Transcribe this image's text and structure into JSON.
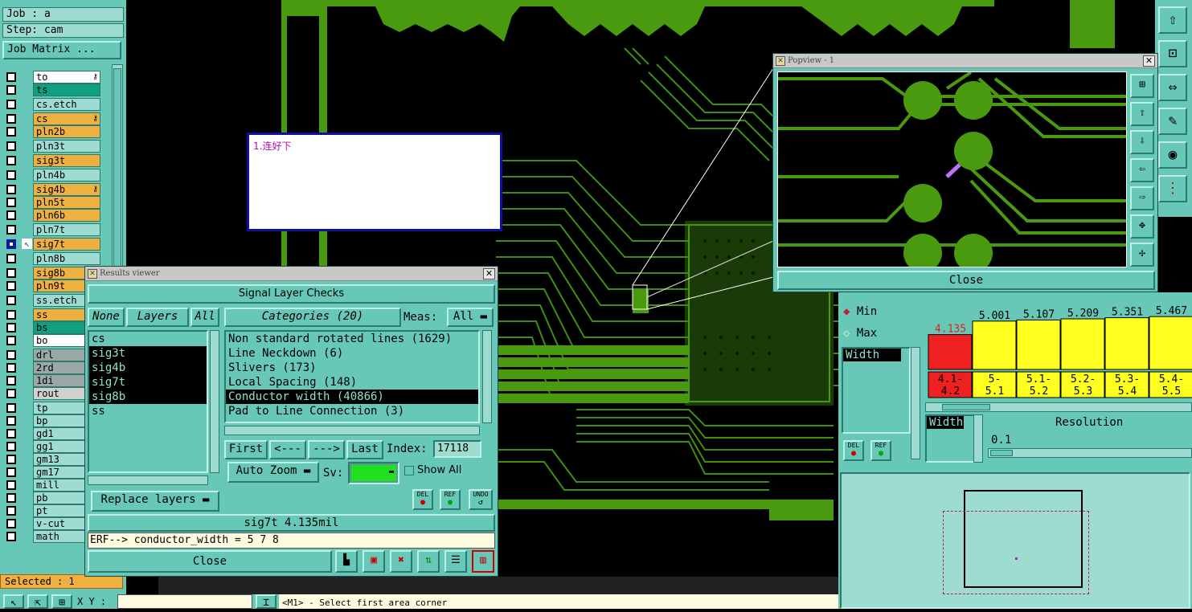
{
  "job": {
    "job_label": "Job : a",
    "step_label": "Step: cam",
    "matrix_button": "Job Matrix ..."
  },
  "layers": [
    {
      "name": "to",
      "color": "#ffffff",
      "lock": true
    },
    {
      "name": "ts",
      "color": "#10a080",
      "lock": false
    },
    {
      "name": "cs.etch",
      "color": "#9edbd0",
      "lock": false
    },
    {
      "name": "cs",
      "color": "#f0b040",
      "lock": true
    },
    {
      "name": "pln2b",
      "color": "#f0b040",
      "lock": false
    },
    {
      "name": "pln3t",
      "color": "#9edbd0",
      "lock": false
    },
    {
      "name": "sig3t",
      "color": "#f0b040",
      "lock": false
    },
    {
      "name": "pln4b",
      "color": "#9edbd0",
      "lock": false
    },
    {
      "name": "sig4b",
      "color": "#f0b040",
      "lock": true
    },
    {
      "name": "pln5t",
      "color": "#f0b040",
      "lock": false
    },
    {
      "name": "pln6b",
      "color": "#f0b040",
      "lock": false
    },
    {
      "name": "pln7t",
      "color": "#9edbd0",
      "lock": false
    },
    {
      "name": "sig7t",
      "color": "#f0b040",
      "lock": false,
      "selected": true
    },
    {
      "name": "pln8b",
      "color": "#9edbd0",
      "lock": false
    },
    {
      "name": "sig8b",
      "color": "#f0b040",
      "lock": false
    },
    {
      "name": "pln9t",
      "color": "#f0b040",
      "lock": false
    },
    {
      "name": "ss.etch",
      "color": "#9edbd0",
      "lock": false
    },
    {
      "name": "ss",
      "color": "#f0b040",
      "lock": false
    },
    {
      "name": "bs",
      "color": "#10a080",
      "lock": false
    },
    {
      "name": "bo",
      "color": "#ffffff",
      "lock": false
    },
    {
      "name": "drl",
      "color": "#9aa8a8",
      "lock": false
    },
    {
      "name": "2rd",
      "color": "#9aa8a8",
      "lock": false
    },
    {
      "name": "1di",
      "color": "#9aa8a8",
      "lock": false
    },
    {
      "name": "rout",
      "color": "#d0d0d0",
      "lock": false
    },
    {
      "name": "tp",
      "color": "#9edbd0",
      "lock": false
    },
    {
      "name": "bp",
      "color": "#9edbd0",
      "lock": false
    },
    {
      "name": "gd1",
      "color": "#9edbd0",
      "lock": false
    },
    {
      "name": "gg1",
      "color": "#9edbd0",
      "lock": false
    },
    {
      "name": "gm13",
      "color": "#9edbd0",
      "lock": false
    },
    {
      "name": "gm17",
      "color": "#9edbd0",
      "lock": false
    },
    {
      "name": "mill",
      "color": "#9edbd0",
      "lock": false
    },
    {
      "name": "pb",
      "color": "#9edbd0",
      "lock": false
    },
    {
      "name": "pt",
      "color": "#9edbd0",
      "lock": false
    },
    {
      "name": "v-cut",
      "color": "#9edbd0",
      "lock": false
    },
    {
      "name": "math",
      "color": "#9edbd0",
      "lock": false
    }
  ],
  "selected_label": "Selected : 1",
  "bottom": {
    "xy_label": "X Y :",
    "command_text": "<M1> - Select first area corner"
  },
  "note": {
    "text": "1.连好下"
  },
  "results_viewer": {
    "title": "Results viewer",
    "header": "Signal Layer Checks",
    "none_btn": "None",
    "layers_btn": "Layers",
    "all_btn": "All",
    "layer_list": [
      {
        "name": "cs",
        "hl": false
      },
      {
        "name": "sig3t",
        "hl": true
      },
      {
        "name": "sig4b",
        "hl": true
      },
      {
        "name": "sig7t",
        "hl": true
      },
      {
        "name": "sig8b",
        "hl": true
      },
      {
        "name": "ss",
        "hl": false
      }
    ],
    "categories_btn": "Categories (20)",
    "meas_label": "Meas:",
    "meas_value": "All",
    "categories": [
      {
        "name": "Non standard rotated lines (1629)",
        "hl": false
      },
      {
        "name": "Line Neckdown (6)",
        "hl": false
      },
      {
        "name": "Slivers (173)",
        "hl": false
      },
      {
        "name": "Local Spacing (148)",
        "hl": false
      },
      {
        "name": "Conductor width (40866)",
        "hl": true
      },
      {
        "name": "Pad to Line Connection (3)",
        "hl": false
      }
    ],
    "first_btn": "First",
    "prev_btn": "<---",
    "next_btn": "--->",
    "last_btn": "Last",
    "index_label": "Index:",
    "index_value": "17118",
    "zoom_label": "Auto Zoom",
    "sv_label": "Sv:",
    "show_all_label": "Show All",
    "replace_label": "Replace layers",
    "del_label": "DEL",
    "ref_label": "REF",
    "undo_label": "UNDO",
    "status": "sig7t 4.135mil",
    "erf_line": "ERF--> conductor_width = 5 7 8",
    "close_label": "Close"
  },
  "popview": {
    "title": "Popview - 1",
    "close_label": "Close"
  },
  "measure": {
    "min_label": "Min",
    "max_label": "Max",
    "width_label": "Width",
    "bars": [
      {
        "value": "4.135",
        "range": "4.1-\n4.2",
        "color": "#ee2020",
        "height": 0.62
      },
      {
        "value": "5.001",
        "range": "5-\n5.1",
        "color": "#ffff20",
        "height": 0.86
      },
      {
        "value": "5.107",
        "range": "5.1-\n5.2",
        "color": "#ffff20",
        "height": 0.88
      },
      {
        "value": "5.209",
        "range": "5.2-\n5.3",
        "color": "#ffff20",
        "height": 0.9
      },
      {
        "value": "5.351",
        "range": "5.3-\n5.4",
        "color": "#ffff20",
        "height": 0.92
      },
      {
        "value": "5.467",
        "range": "5.4-\n5.5",
        "color": "#ffff20",
        "height": 0.94
      }
    ],
    "resolution_label": "Resolution",
    "resolution_value": "0.1",
    "width_tag": "Width",
    "del_label": "DEL",
    "ref_label": "REF"
  },
  "colors": {
    "panel": "#68c8b8",
    "pcb_green": "#4a9a10",
    "copper_dark": "#3a8a08"
  }
}
